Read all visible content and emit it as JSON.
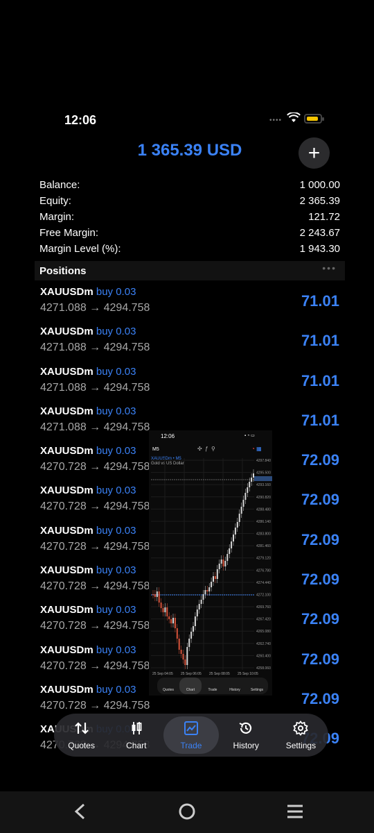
{
  "status": {
    "time": "12:06"
  },
  "header": {
    "title": "1 365.39 USD",
    "add_label": "+"
  },
  "summary": [
    {
      "label": "Balance:",
      "value": "1 000.00"
    },
    {
      "label": "Equity:",
      "value": "2 365.39"
    },
    {
      "label": "Margin:",
      "value": "121.72"
    },
    {
      "label": "Free Margin:",
      "value": "2 243.67"
    },
    {
      "label": "Margin Level (%):",
      "value": "1 943.30"
    }
  ],
  "positions": {
    "title": "Positions",
    "more": "•••",
    "items": [
      {
        "symbol": "XAUUSDm",
        "side": "buy 0.03",
        "prices": "4271.088 → 4294.758",
        "pl": "71.01"
      },
      {
        "symbol": "XAUUSDm",
        "side": "buy 0.03",
        "prices": "4271.088 → 4294.758",
        "pl": "71.01"
      },
      {
        "symbol": "XAUUSDm",
        "side": "buy 0.03",
        "prices": "4271.088 → 4294.758",
        "pl": "71.01"
      },
      {
        "symbol": "XAUUSDm",
        "side": "buy 0.03",
        "prices": "4271.088 → 4294.758",
        "pl": "71.01"
      },
      {
        "symbol": "XAUUSDm",
        "side": "buy 0.03",
        "prices": "4270.728 → 4294.758",
        "pl": "72.09"
      },
      {
        "symbol": "XAUUSDm",
        "side": "buy 0.03",
        "prices": "4270.728 → 4294.758",
        "pl": "72.09"
      },
      {
        "symbol": "XAUUSDm",
        "side": "buy 0.03",
        "prices": "4270.728 → 4294.758",
        "pl": "72.09"
      },
      {
        "symbol": "XAUUSDm",
        "side": "buy 0.03",
        "prices": "4270.728 → 4294.758",
        "pl": "72.09"
      },
      {
        "symbol": "XAUUSDm",
        "side": "buy 0.03",
        "prices": "4270.728 → 4294.758",
        "pl": "72.09"
      },
      {
        "symbol": "XAUUSDm",
        "side": "buy 0.03",
        "prices": "4270.728 → 4294.758",
        "pl": "72.09"
      },
      {
        "symbol": "XAUUSDm",
        "side": "buy 0.03",
        "prices": "4270.728 → 4294.758",
        "pl": "72.09"
      },
      {
        "symbol": "XAUUSDm",
        "side": "buy 0.03",
        "prices": "4270.728 → 4294.758",
        "pl": "72.09"
      }
    ]
  },
  "tabs": [
    {
      "label": "Quotes",
      "icon": "arrows-updown-icon"
    },
    {
      "label": "Chart",
      "icon": "candles-icon"
    },
    {
      "label": "Trade",
      "icon": "trade-chart-icon",
      "active": true
    },
    {
      "label": "History",
      "icon": "history-icon"
    },
    {
      "label": "Settings",
      "icon": "gear-icon"
    }
  ],
  "mini": {
    "time": "12:06",
    "timeframe": "M5",
    "symbol": "XAUUSDm • M5",
    "description": "Gold vs US Dollar",
    "x_labels": [
      "25 Sep 04:05",
      "25 Sep 06:05",
      "25 Sep 08:05",
      "25 Sep 10:05"
    ],
    "y_labels": [
      "4297.840",
      "4295.500",
      "4293.160",
      "4290.820",
      "4288.480",
      "4286.140",
      "4283.800",
      "4281.460",
      "4279.120",
      "4276.780",
      "4274.440",
      "4272.100",
      "4269.760",
      "4267.420",
      "4265.080",
      "4262.740",
      "4260.400",
      "4258.060"
    ],
    "tabs": [
      "Quotes",
      "Chart",
      "Trade",
      "History",
      "Settings"
    ]
  },
  "colors": {
    "accent": "#3b82f6",
    "background": "#000000",
    "battery": "#f5c400"
  }
}
